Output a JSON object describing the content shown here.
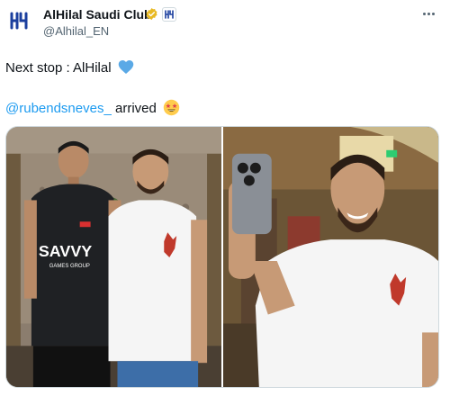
{
  "account": {
    "display_name": "AlHilal Saudi Club",
    "handle": "@Alhilal_EN",
    "avatar_icon": "alhilal-logo-icon",
    "verified_color": "#e8b923",
    "brand_color": "#1b3f9e"
  },
  "tweet": {
    "line1_text": "Next stop : AlHilal",
    "line1_emoji": "blue-heart-icon",
    "mention": "@rubendsneves_",
    "mention_suffix": " arrived",
    "line2_emoji": "star-struck-icon",
    "mention_color": "#1d9bf0"
  },
  "media": {
    "left_photo": {
      "kit_sponsor": "SAVVY",
      "kit_sponsor_sub": "GAMES GROUP"
    },
    "right_photo": {}
  }
}
